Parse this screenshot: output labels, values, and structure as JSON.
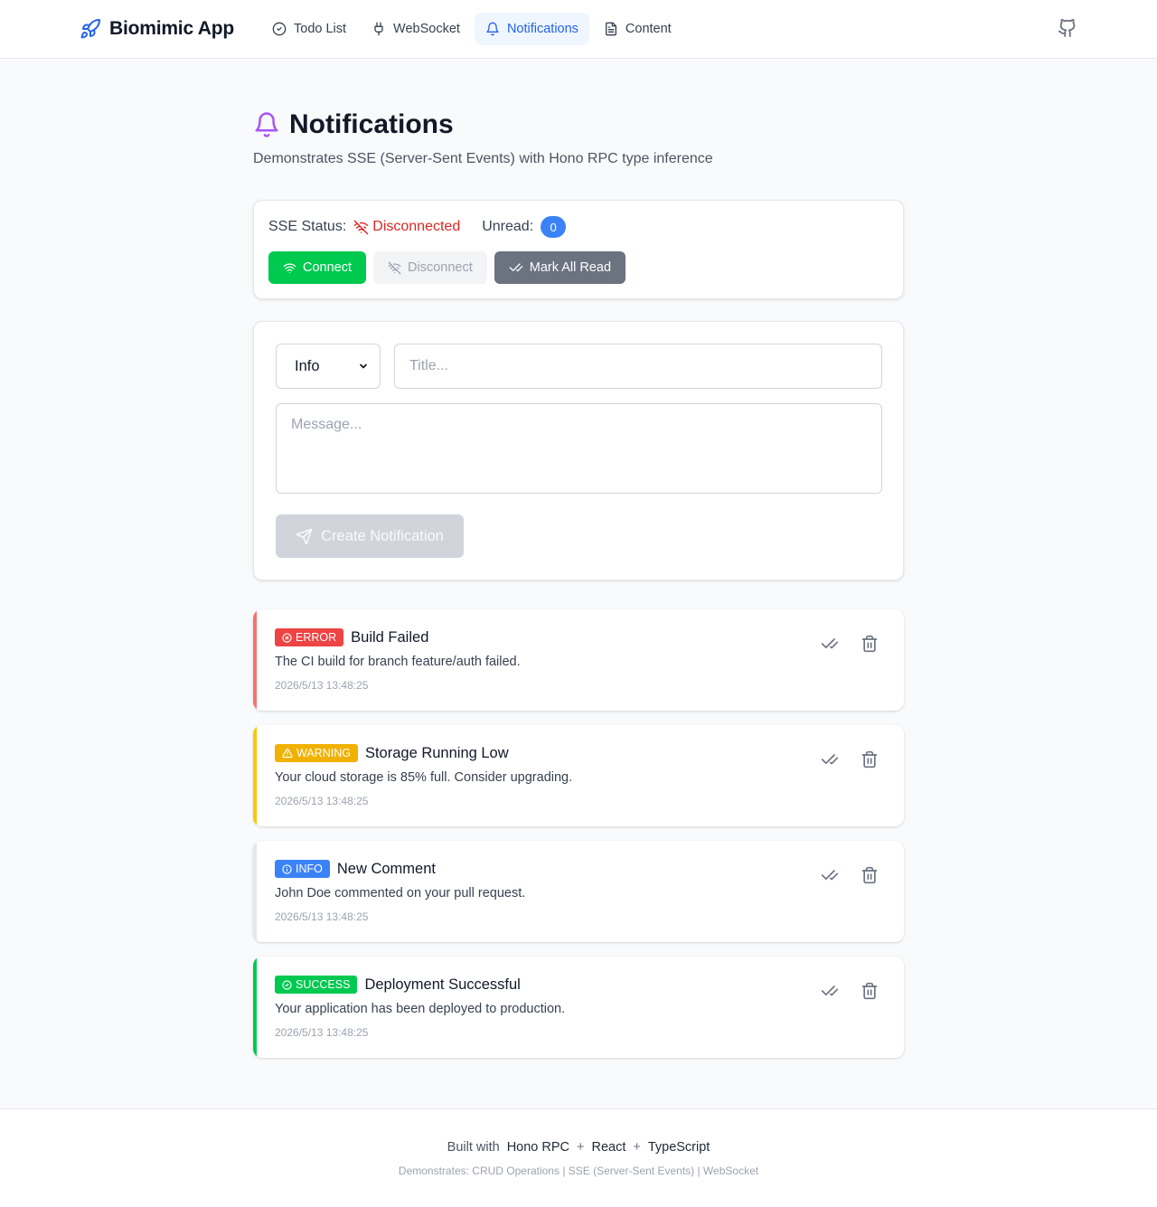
{
  "header": {
    "brand": "Biomimic App",
    "nav": [
      {
        "label": "Todo List",
        "icon": "circle-check-icon",
        "active": false
      },
      {
        "label": "WebSocket",
        "icon": "plug-icon",
        "active": false
      },
      {
        "label": "Notifications",
        "icon": "bell-icon",
        "active": true
      },
      {
        "label": "Content",
        "icon": "file-text-icon",
        "active": false
      }
    ],
    "github_icon": "github-icon"
  },
  "page": {
    "title": "Notifications",
    "subtitle": "Demonstrates SSE (Server-Sent Events) with Hono RPC type inference"
  },
  "status": {
    "label": "SSE Status:",
    "value": "Disconnected",
    "unread_label": "Unread:",
    "unread_count": "0",
    "connect_label": "Connect",
    "disconnect_label": "Disconnect",
    "mark_all_label": "Mark All Read"
  },
  "form": {
    "type_value": "Info",
    "title_placeholder": "Title...",
    "message_placeholder": "Message...",
    "create_label": "Create Notification"
  },
  "notifications": [
    {
      "type": "ERROR",
      "color": "#ef4444",
      "accent": "#f87171",
      "title": "Build Failed",
      "message": "The CI build for branch feature/auth failed.",
      "time": "2026/5/13 13:48:25"
    },
    {
      "type": "WARNING",
      "color": "#f0b100",
      "accent": "#fac800",
      "title": "Storage Running Low",
      "message": "Your cloud storage is 85% full. Consider upgrading.",
      "time": "2026/5/13 13:48:25"
    },
    {
      "type": "INFO",
      "color": "#3b82f6",
      "accent": "#e5e7eb",
      "title": "New Comment",
      "message": "John Doe commented on your pull request.",
      "time": "2026/5/13 13:48:25"
    },
    {
      "type": "SUCCESS",
      "color": "#00c950",
      "accent": "#00c950",
      "title": "Deployment Successful",
      "message": "Your application has been deployed to production.",
      "time": "2026/5/13 13:48:25"
    }
  ],
  "footer": {
    "built_with": "Built with",
    "tech1": "Hono RPC",
    "plus1": "+",
    "tech2": "React",
    "plus2": "+",
    "tech3": "TypeScript",
    "demonstrates": "Demonstrates: CRUD Operations | SSE (Server-Sent Events) | WebSocket"
  }
}
